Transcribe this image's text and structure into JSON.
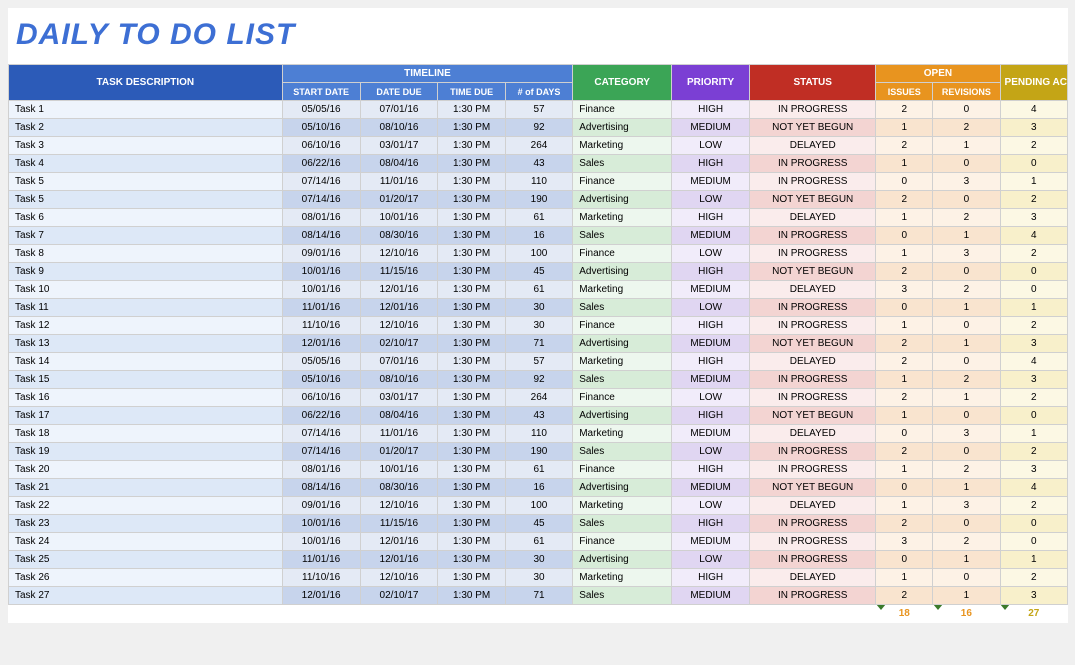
{
  "title": "DAILY TO DO LIST",
  "headers": {
    "task": "TASK DESCRIPTION",
    "timeline": "TIMELINE",
    "category": "CATEGORY",
    "priority": "PRIORITY",
    "status": "STATUS",
    "open": "OPEN",
    "pending": "PENDING ACTIONS",
    "start": "START DATE",
    "due": "DATE DUE",
    "time": "TIME DUE",
    "days": "# of DAYS",
    "issues": "ISSUES",
    "revisions": "REVISIONS"
  },
  "rows": [
    {
      "task": "Task 1",
      "start": "05/05/16",
      "due": "07/01/16",
      "time": "1:30 PM",
      "days": "57",
      "cat": "Finance",
      "pri": "HIGH",
      "stat": "IN PROGRESS",
      "iss": "2",
      "rev": "0",
      "pend": "4"
    },
    {
      "task": "Task 2",
      "start": "05/10/16",
      "due": "08/10/16",
      "time": "1:30 PM",
      "days": "92",
      "cat": "Advertising",
      "pri": "MEDIUM",
      "stat": "NOT YET BEGUN",
      "iss": "1",
      "rev": "2",
      "pend": "3"
    },
    {
      "task": "Task 3",
      "start": "06/10/16",
      "due": "03/01/17",
      "time": "1:30 PM",
      "days": "264",
      "cat": "Marketing",
      "pri": "LOW",
      "stat": "DELAYED",
      "iss": "2",
      "rev": "1",
      "pend": "2"
    },
    {
      "task": "Task 4",
      "start": "06/22/16",
      "due": "08/04/16",
      "time": "1:30 PM",
      "days": "43",
      "cat": "Sales",
      "pri": "HIGH",
      "stat": "IN PROGRESS",
      "iss": "1",
      "rev": "0",
      "pend": "0"
    },
    {
      "task": "Task 5",
      "start": "07/14/16",
      "due": "11/01/16",
      "time": "1:30 PM",
      "days": "110",
      "cat": "Finance",
      "pri": "MEDIUM",
      "stat": "IN PROGRESS",
      "iss": "0",
      "rev": "3",
      "pend": "1"
    },
    {
      "task": "Task 5",
      "start": "07/14/16",
      "due": "01/20/17",
      "time": "1:30 PM",
      "days": "190",
      "cat": "Advertising",
      "pri": "LOW",
      "stat": "NOT YET BEGUN",
      "iss": "2",
      "rev": "0",
      "pend": "2"
    },
    {
      "task": "Task 6",
      "start": "08/01/16",
      "due": "10/01/16",
      "time": "1:30 PM",
      "days": "61",
      "cat": "Marketing",
      "pri": "HIGH",
      "stat": "DELAYED",
      "iss": "1",
      "rev": "2",
      "pend": "3"
    },
    {
      "task": "Task 7",
      "start": "08/14/16",
      "due": "08/30/16",
      "time": "1:30 PM",
      "days": "16",
      "cat": "Sales",
      "pri": "MEDIUM",
      "stat": "IN PROGRESS",
      "iss": "0",
      "rev": "1",
      "pend": "4"
    },
    {
      "task": "Task 8",
      "start": "09/01/16",
      "due": "12/10/16",
      "time": "1:30 PM",
      "days": "100",
      "cat": "Finance",
      "pri": "LOW",
      "stat": "IN PROGRESS",
      "iss": "1",
      "rev": "3",
      "pend": "2"
    },
    {
      "task": "Task 9",
      "start": "10/01/16",
      "due": "11/15/16",
      "time": "1:30 PM",
      "days": "45",
      "cat": "Advertising",
      "pri": "HIGH",
      "stat": "NOT YET BEGUN",
      "iss": "2",
      "rev": "0",
      "pend": "0"
    },
    {
      "task": "Task 10",
      "start": "10/01/16",
      "due": "12/01/16",
      "time": "1:30 PM",
      "days": "61",
      "cat": "Marketing",
      "pri": "MEDIUM",
      "stat": "DELAYED",
      "iss": "3",
      "rev": "2",
      "pend": "0"
    },
    {
      "task": "Task 11",
      "start": "11/01/16",
      "due": "12/01/16",
      "time": "1:30 PM",
      "days": "30",
      "cat": "Sales",
      "pri": "LOW",
      "stat": "IN PROGRESS",
      "iss": "0",
      "rev": "1",
      "pend": "1"
    },
    {
      "task": "Task 12",
      "start": "11/10/16",
      "due": "12/10/16",
      "time": "1:30 PM",
      "days": "30",
      "cat": "Finance",
      "pri": "HIGH",
      "stat": "IN PROGRESS",
      "iss": "1",
      "rev": "0",
      "pend": "2"
    },
    {
      "task": "Task 13",
      "start": "12/01/16",
      "due": "02/10/17",
      "time": "1:30 PM",
      "days": "71",
      "cat": "Advertising",
      "pri": "MEDIUM",
      "stat": "NOT YET BEGUN",
      "iss": "2",
      "rev": "1",
      "pend": "3"
    },
    {
      "task": "Task 14",
      "start": "05/05/16",
      "due": "07/01/16",
      "time": "1:30 PM",
      "days": "57",
      "cat": "Marketing",
      "pri": "HIGH",
      "stat": "DELAYED",
      "iss": "2",
      "rev": "0",
      "pend": "4"
    },
    {
      "task": "Task 15",
      "start": "05/10/16",
      "due": "08/10/16",
      "time": "1:30 PM",
      "days": "92",
      "cat": "Sales",
      "pri": "MEDIUM",
      "stat": "IN PROGRESS",
      "iss": "1",
      "rev": "2",
      "pend": "3"
    },
    {
      "task": "Task 16",
      "start": "06/10/16",
      "due": "03/01/17",
      "time": "1:30 PM",
      "days": "264",
      "cat": "Finance",
      "pri": "LOW",
      "stat": "IN PROGRESS",
      "iss": "2",
      "rev": "1",
      "pend": "2"
    },
    {
      "task": "Task 17",
      "start": "06/22/16",
      "due": "08/04/16",
      "time": "1:30 PM",
      "days": "43",
      "cat": "Advertising",
      "pri": "HIGH",
      "stat": "NOT YET BEGUN",
      "iss": "1",
      "rev": "0",
      "pend": "0"
    },
    {
      "task": "Task 18",
      "start": "07/14/16",
      "due": "11/01/16",
      "time": "1:30 PM",
      "days": "110",
      "cat": "Marketing",
      "pri": "MEDIUM",
      "stat": "DELAYED",
      "iss": "0",
      "rev": "3",
      "pend": "1"
    },
    {
      "task": "Task 19",
      "start": "07/14/16",
      "due": "01/20/17",
      "time": "1:30 PM",
      "days": "190",
      "cat": "Sales",
      "pri": "LOW",
      "stat": "IN PROGRESS",
      "iss": "2",
      "rev": "0",
      "pend": "2"
    },
    {
      "task": "Task 20",
      "start": "08/01/16",
      "due": "10/01/16",
      "time": "1:30 PM",
      "days": "61",
      "cat": "Finance",
      "pri": "HIGH",
      "stat": "IN PROGRESS",
      "iss": "1",
      "rev": "2",
      "pend": "3"
    },
    {
      "task": "Task 21",
      "start": "08/14/16",
      "due": "08/30/16",
      "time": "1:30 PM",
      "days": "16",
      "cat": "Advertising",
      "pri": "MEDIUM",
      "stat": "NOT YET BEGUN",
      "iss": "0",
      "rev": "1",
      "pend": "4"
    },
    {
      "task": "Task 22",
      "start": "09/01/16",
      "due": "12/10/16",
      "time": "1:30 PM",
      "days": "100",
      "cat": "Marketing",
      "pri": "LOW",
      "stat": "DELAYED",
      "iss": "1",
      "rev": "3",
      "pend": "2"
    },
    {
      "task": "Task 23",
      "start": "10/01/16",
      "due": "11/15/16",
      "time": "1:30 PM",
      "days": "45",
      "cat": "Sales",
      "pri": "HIGH",
      "stat": "IN PROGRESS",
      "iss": "2",
      "rev": "0",
      "pend": "0"
    },
    {
      "task": "Task 24",
      "start": "10/01/16",
      "due": "12/01/16",
      "time": "1:30 PM",
      "days": "61",
      "cat": "Finance",
      "pri": "MEDIUM",
      "stat": "IN PROGRESS",
      "iss": "3",
      "rev": "2",
      "pend": "0"
    },
    {
      "task": "Task 25",
      "start": "11/01/16",
      "due": "12/01/16",
      "time": "1:30 PM",
      "days": "30",
      "cat": "Advertising",
      "pri": "LOW",
      "stat": "IN PROGRESS",
      "iss": "0",
      "rev": "1",
      "pend": "1"
    },
    {
      "task": "Task 26",
      "start": "11/10/16",
      "due": "12/10/16",
      "time": "1:30 PM",
      "days": "30",
      "cat": "Marketing",
      "pri": "HIGH",
      "stat": "DELAYED",
      "iss": "1",
      "rev": "0",
      "pend": "2"
    },
    {
      "task": "Task 27",
      "start": "12/01/16",
      "due": "02/10/17",
      "time": "1:30 PM",
      "days": "71",
      "cat": "Sales",
      "pri": "MEDIUM",
      "stat": "IN PROGRESS",
      "iss": "2",
      "rev": "1",
      "pend": "3"
    }
  ],
  "totals": {
    "issues": "18",
    "revisions": "16",
    "pending": "27"
  }
}
